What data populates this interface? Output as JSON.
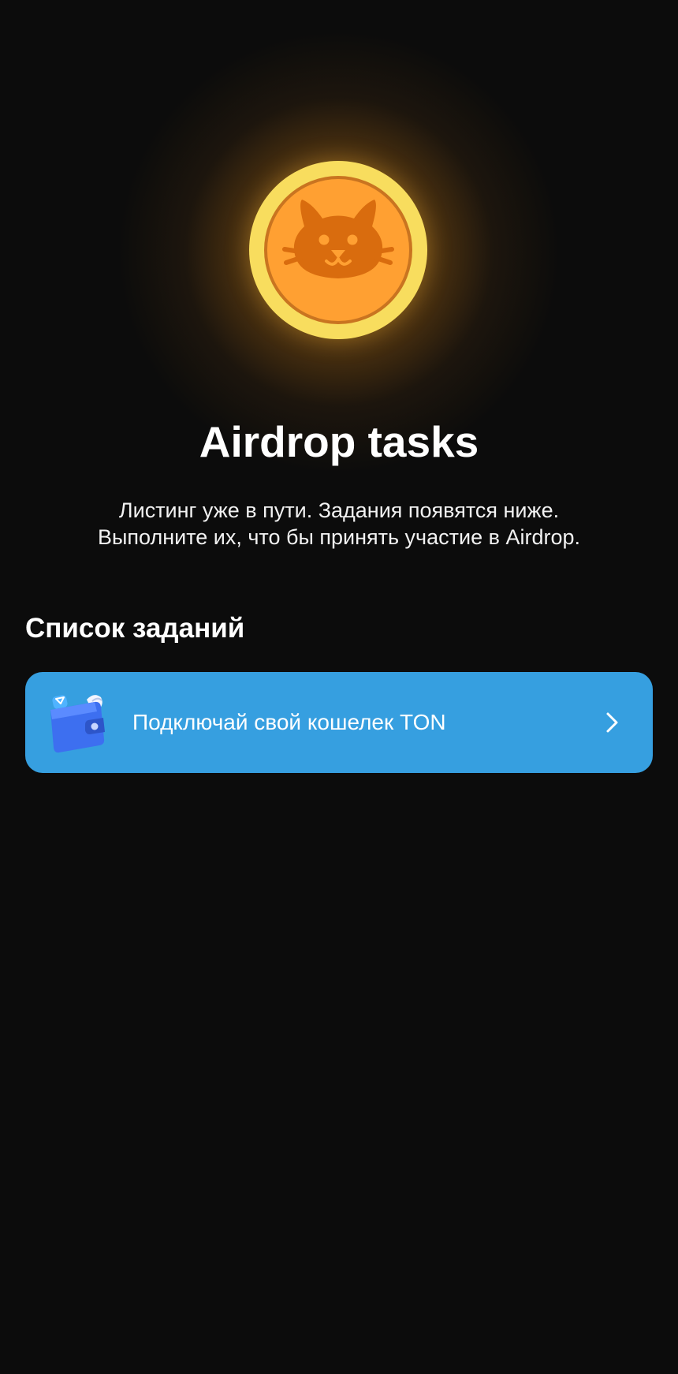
{
  "hero": {
    "title": "Airdrop tasks",
    "subtitle_lines": [
      "Листинг уже в пути. Задания появятся ниже.",
      "Выполните их, что бы принять участие в Airdrop."
    ],
    "coin_icon": "cat-coin-icon"
  },
  "tasks": {
    "section_title": "Список заданий",
    "items": [
      {
        "label": "Подключай свой кошелек TON",
        "icon": "wallet-icon",
        "trailing_icon": "chevron-right-icon"
      }
    ]
  },
  "colors": {
    "background": "#0c0c0c",
    "card": "#369fe0",
    "coin_outer": "#f8dd5e",
    "coin_inner": "#ffa032",
    "cat": "#d96c0e"
  }
}
